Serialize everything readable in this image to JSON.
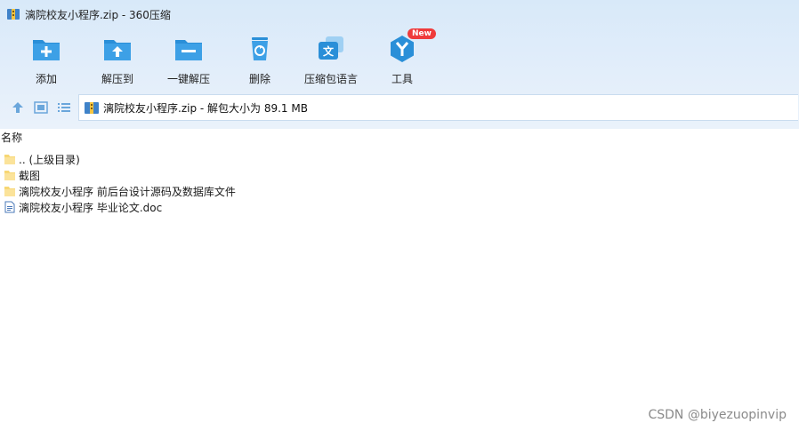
{
  "window": {
    "title": "漓院校友小程序.zip - 360压缩"
  },
  "toolbar": {
    "add_label": "添加",
    "extract_to_label": "解压到",
    "one_click_extract_label": "一键解压",
    "delete_label": "删除",
    "archive_language_label": "压缩包语言",
    "tools_label": "工具",
    "tools_badge": "New"
  },
  "address": {
    "text": "漓院校友小程序.zip - 解包大小为 89.1 MB"
  },
  "list": {
    "column_name": "名称",
    "items": [
      {
        "name": ".. (上级目录)",
        "icon": "folder-icon"
      },
      {
        "name": "截图",
        "icon": "folder-icon"
      },
      {
        "name": "漓院校友小程序 前后台设计源码及数据库文件",
        "icon": "folder-icon"
      },
      {
        "name": "漓院校友小程序 毕业论文.doc",
        "icon": "word-doc-icon"
      }
    ]
  },
  "watermark": "CSDN @biyezuopinvip",
  "colors": {
    "accent": "#2a8fd8",
    "folder": "#f7d774",
    "badge": "#ef3b3b"
  }
}
